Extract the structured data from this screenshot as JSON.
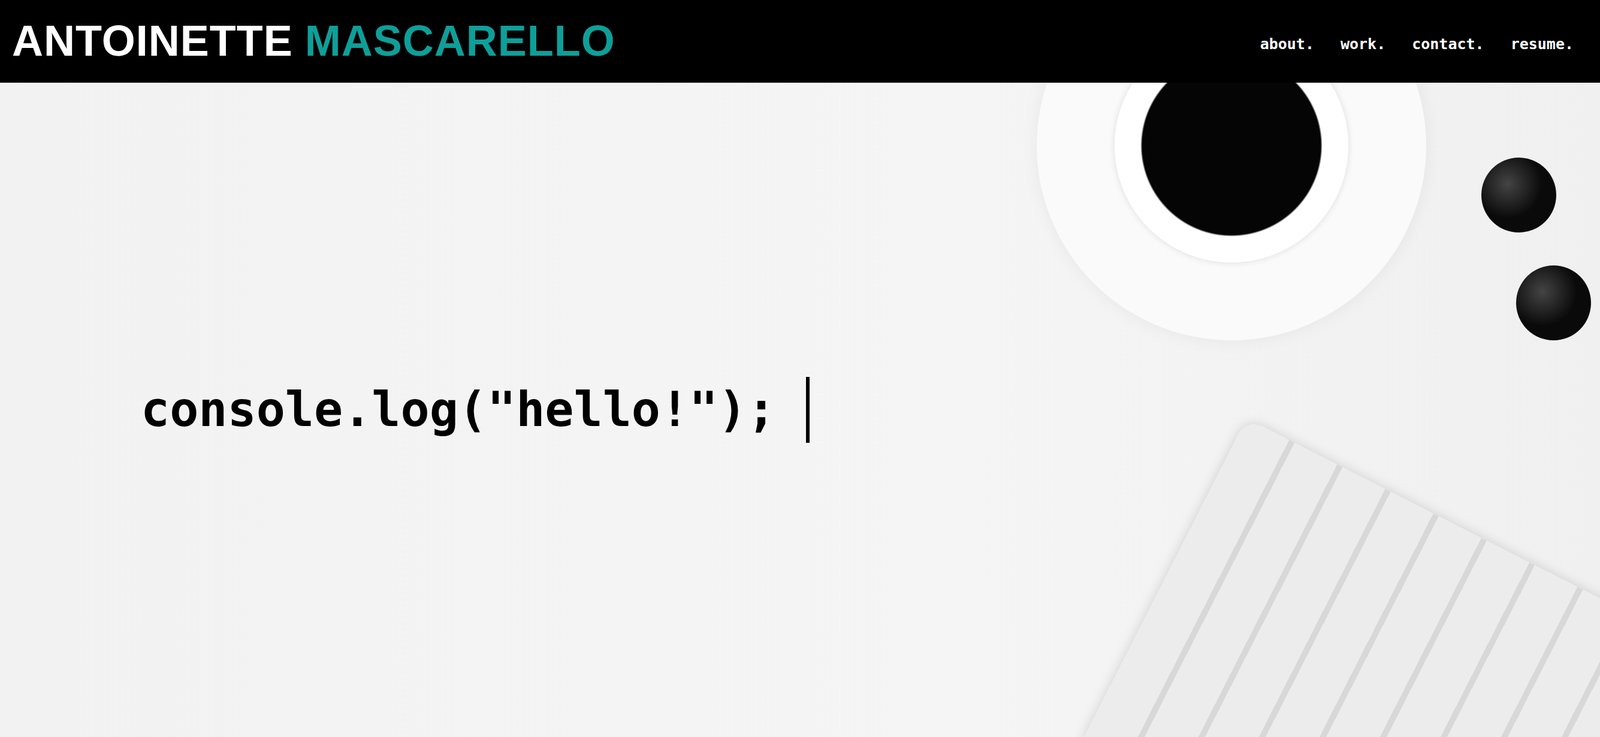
{
  "header": {
    "logo_first": "ANTOINETTE",
    "logo_last": "MASCARELLO"
  },
  "nav": [
    {
      "label": "about."
    },
    {
      "label": "work."
    },
    {
      "label": "contact."
    },
    {
      "label": "resume."
    }
  ],
  "hero": {
    "typed_text": "console.log(\"hello!\");",
    "cursor_visible": true
  }
}
